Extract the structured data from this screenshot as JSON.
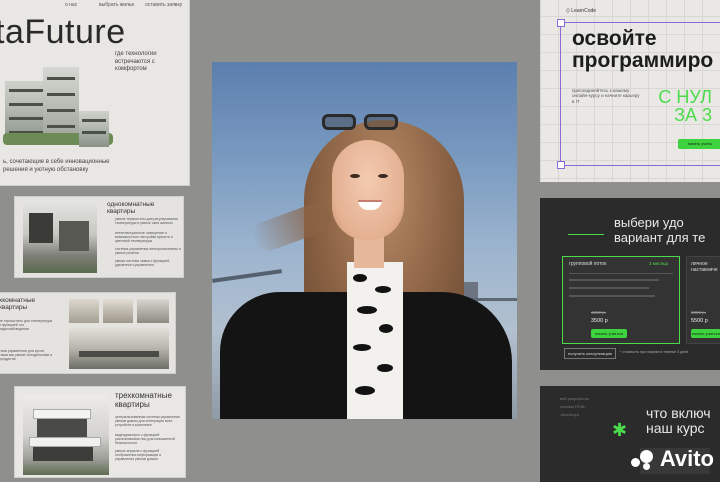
{
  "panel1": {
    "top_labels": [
      "о нас",
      "выбрать жилье",
      "оставить заявку"
    ],
    "title": "taFuture",
    "tagline": "где технологии встречаются с комфортом",
    "desc": "ь, сочетающие в себе инновационные решения и уютную обстановку"
  },
  "panel2": {
    "heading": "однокомнатные квартиры",
    "features": [
      "умные термостаты для регулирования температуры и умные окна жалюзи",
      "интеллектуальное освещение и возможностью настройки яркости и цветовой температуры",
      "система управления электропитанием и умные розетки",
      "умная система замка с функцией удаленного управления"
    ]
  },
  "panel3": {
    "heading": "хкомнатные квартиры",
    "desc": "ие термостаты для температуры и функцией ого видеонаблюдения",
    "desc2": "тема управления для кухни, такая как умные холодильники и продуктов"
  },
  "panel4": {
    "heading": "трехкомнатные квартиры",
    "features": [
      "централизованная система управления умным домом для интеграции всех устройств в комплексе",
      "видеодомофон с функцией распознавания лиц для повышенной безопасности",
      "умные зеркала с функцией отображения информации и управления умным домом"
    ]
  },
  "panel5": {
    "brand": "LearnCode",
    "title": "освойте программиро",
    "sub": "присоединяйтесь к нашему онлайн-курсу и начните карьеру в IT",
    "neon": "С НУЛ ЗА 3",
    "button": "начать учиты"
  },
  "panel6": {
    "title": "выбери удо вариант для те",
    "card1": {
      "name": "групповой поток",
      "months": "3 месяца",
      "old_price": "4000 р.",
      "price": "3500 р",
      "button": "начать учиться"
    },
    "card2": {
      "name": "личное наставниче",
      "old_price": "6000 р.",
      "price": "5500 р",
      "button": "начать учиться"
    },
    "consult": "получить консультацию",
    "note": "* стоимость при покупке в течение 3 дней"
  },
  "panel7": {
    "tags": [
      "веб-разработка",
      "основы HTML",
      "JavaScript"
    ],
    "title": "что включ наш курс"
  },
  "watermark": "Avito",
  "colors": {
    "neon_green": "#4bdb4b",
    "purple_frame": "#8c6bd9",
    "dark_panel": "#2b2b2b",
    "light_panel": "#e8e7e4"
  }
}
